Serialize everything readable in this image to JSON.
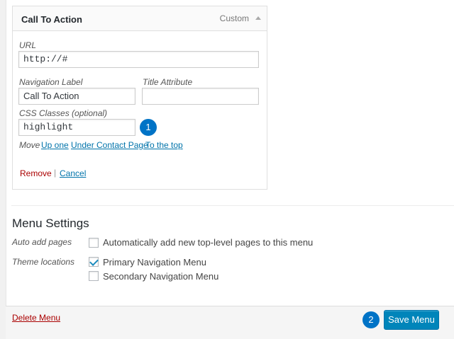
{
  "menu_item": {
    "title": "Call To Action",
    "type": "Custom",
    "url_label": "URL",
    "url_value": "http://#",
    "nav_label_label": "Navigation Label",
    "nav_label_value": "Call To Action",
    "title_attr_label": "Title Attribute",
    "title_attr_value": "",
    "css_label": "CSS Classes (optional)",
    "css_value": "highlight",
    "move_label": "Move",
    "move_links": [
      "Up one",
      "Under Contact Page",
      "To the top"
    ],
    "remove_label": "Remove",
    "divider": "|",
    "cancel_label": "Cancel"
  },
  "callouts": [
    "1",
    "2"
  ],
  "menu_settings": {
    "heading": "Menu Settings",
    "auto_add_label": "Auto add pages",
    "auto_add_option": "Automatically add new top-level pages to this menu",
    "auto_add_checked": false,
    "theme_locations_label": "Theme locations",
    "locations": [
      {
        "label": "Primary Navigation Menu",
        "checked": true
      },
      {
        "label": "Secondary Navigation Menu",
        "checked": false
      }
    ]
  },
  "footer": {
    "delete_label": "Delete Menu",
    "save_label": "Save Menu"
  },
  "colors": {
    "accent": "#0085ba",
    "link": "#0073aa",
    "delete": "#a00",
    "callout": "#0073c6"
  }
}
